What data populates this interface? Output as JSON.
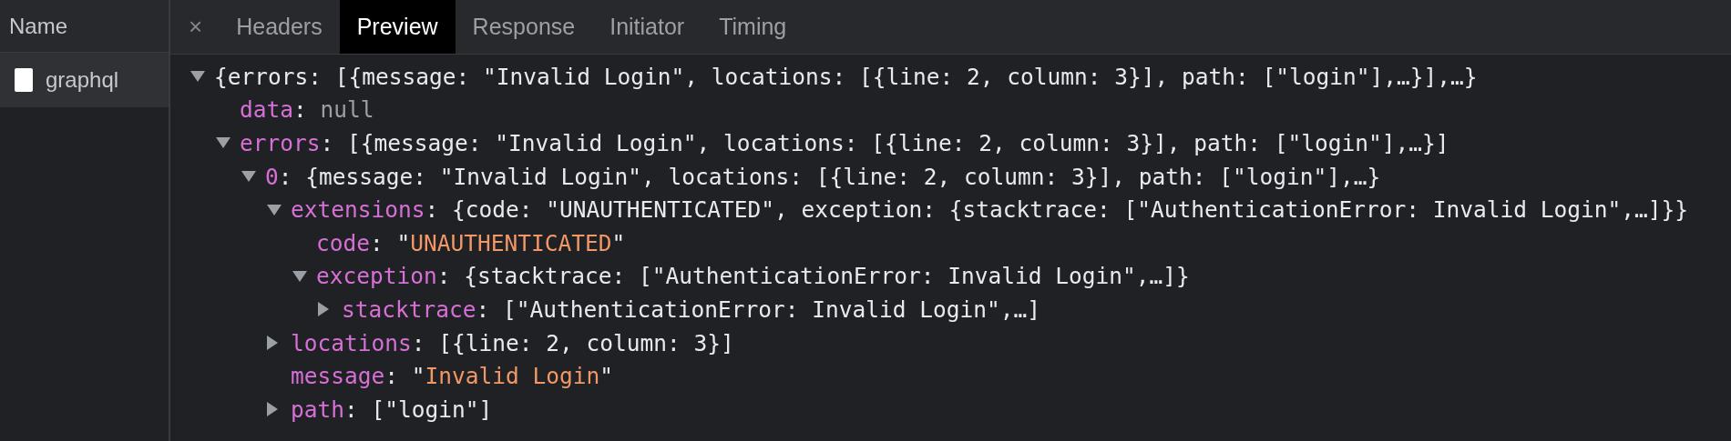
{
  "sidebar": {
    "header": "Name",
    "items": [
      {
        "label": "graphql",
        "selected": true
      }
    ]
  },
  "tabs": [
    {
      "label": "×",
      "kind": "close"
    },
    {
      "label": "Headers",
      "kind": "tab",
      "selected": false
    },
    {
      "label": "Preview",
      "kind": "tab",
      "selected": true
    },
    {
      "label": "Response",
      "kind": "tab",
      "selected": false
    },
    {
      "label": "Initiator",
      "kind": "tab",
      "selected": false
    },
    {
      "label": "Timing",
      "kind": "tab",
      "selected": false
    }
  ],
  "separator": ": ",
  "tree": {
    "preview": "{errors: [{message: \"Invalid Login\", locations: [{line: 2, column: 3}], path: [\"login\"],…}],…}",
    "expanded": true,
    "children": [
      {
        "key": "data",
        "value": "null",
        "kind": "null"
      },
      {
        "key": "errors",
        "preview": "[{message: \"Invalid Login\", locations: [{line: 2, column: 3}], path: [\"login\"],…}]",
        "expanded": true,
        "children": [
          {
            "key": "0",
            "preview": "{message: \"Invalid Login\", locations: [{line: 2, column: 3}], path: [\"login\"],…}",
            "expanded": true,
            "children": [
              {
                "key": "extensions",
                "preview": "{code: \"UNAUTHENTICATED\", exception: {stacktrace: [\"AuthenticationError: Invalid Login\",…]}}",
                "expanded": true,
                "children": [
                  {
                    "key": "code",
                    "value": "\"UNAUTHENTICATED\"",
                    "kind": "string"
                  },
                  {
                    "key": "exception",
                    "preview": "{stacktrace: [\"AuthenticationError: Invalid Login\",…]}",
                    "expanded": true,
                    "children": [
                      {
                        "key": "stacktrace",
                        "preview": "[\"AuthenticationError: Invalid Login\",…]",
                        "expanded": false
                      }
                    ]
                  }
                ]
              },
              {
                "key": "locations",
                "preview": "[{line: 2, column: 3}]",
                "expanded": false
              },
              {
                "key": "message",
                "value": "\"Invalid Login\"",
                "kind": "string"
              },
              {
                "key": "path",
                "preview": "[\"login\"]",
                "expanded": false
              }
            ]
          }
        ]
      }
    ]
  }
}
